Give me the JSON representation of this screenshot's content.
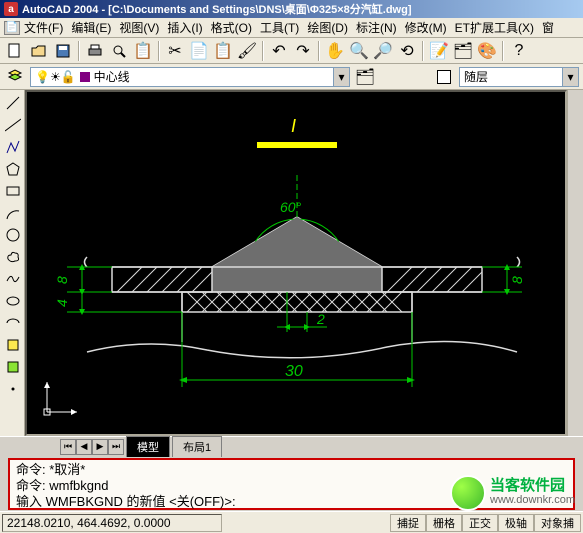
{
  "app_icon_letter": "a",
  "title": "AutoCAD 2004 - [C:\\Documents and Settings\\DNS\\桌面\\Φ325×8分汽缸.dwg]",
  "menus": {
    "file": "文件(F)",
    "edit": "编辑(E)",
    "view": "视图(V)",
    "insert": "插入(I)",
    "format": "格式(O)",
    "tools": "工具(T)",
    "draw": "绘图(D)",
    "dimension": "标注(N)",
    "modify": "修改(M)",
    "ettools": "ET扩展工具(X)",
    "window": "窗"
  },
  "layer_dropdown": "中心线",
  "layer_right_dropdown": "随层",
  "tabs": {
    "model": "模型",
    "layout1": "布局1"
  },
  "command": {
    "l1": "命令: *取消*",
    "l2": "命令:  wmfbkgnd",
    "l3": "输入 WMFBKGND 的新值 <关(OFF)>:"
  },
  "status": {
    "coords": "22148.0210, 464.4692, 0.0000",
    "snap": "捕捉",
    "grid": "栅格",
    "ortho": "正交",
    "polar": "极轴",
    "osnap": "对象捕"
  },
  "watermark": {
    "name": "当客软件园",
    "url": "www.downkr.com"
  },
  "drawing": {
    "angle_label": "60°",
    "dim_30": "30",
    "dim_2": "2",
    "dim_8_left": "8",
    "dim_4_left": "4",
    "dim_8_right": "8",
    "top_mark": "I"
  }
}
